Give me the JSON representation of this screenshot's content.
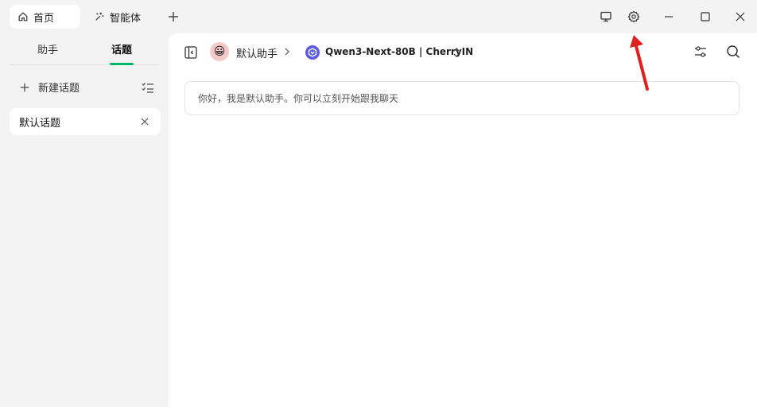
{
  "titlebar": {
    "tabs": [
      {
        "label": "首页",
        "icon": "home-icon",
        "active": true
      },
      {
        "label": "智能体",
        "icon": "sparkle-icon",
        "active": false
      }
    ]
  },
  "sidebar": {
    "tabs": [
      "助手",
      "话题"
    ],
    "active_tab": "话题",
    "new_topic_label": "新建话题",
    "topics": [
      {
        "label": "默认话题"
      }
    ],
    "accent_color": "#00b96b"
  },
  "main": {
    "assistant_name": "默认助手",
    "assistant_avatar": "😀",
    "model_name": "Qwen3-Next-80B | CherryIN",
    "welcome_message": "你好，我是默认助手。你可以立刻开始跟我聊天"
  },
  "annotation": {
    "arrow_color": "#e02020"
  }
}
